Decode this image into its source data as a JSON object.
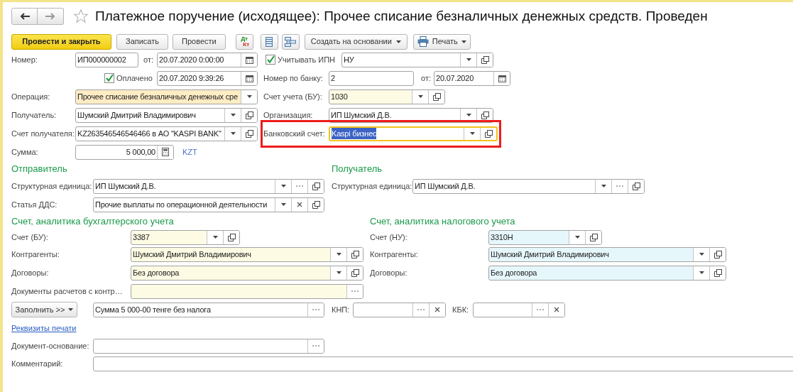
{
  "title": "Платежное поручение (исходящее): Прочее списание безналичных денежных средств. Проведен",
  "toolbar": [
    {
      "kind": "primary",
      "label": "Провести и закрыть"
    },
    {
      "kind": "button",
      "label": "Записать"
    },
    {
      "kind": "button",
      "label": "Провести"
    },
    {
      "kind": "dtkt",
      "top": "Дт",
      "bottom": "Кт"
    },
    {
      "kind": "list"
    },
    {
      "kind": "structure"
    },
    {
      "kind": "menu",
      "label": "Создать на основании"
    },
    {
      "kind": "print_menu",
      "label": "Печать"
    }
  ],
  "number": {
    "label": "Номер:",
    "value": "ИП000000002"
  },
  "date": {
    "label": "от:",
    "value": "20.07.2020  0:00:00",
    "buttons": [
      {
        "kind": "calendar"
      }
    ]
  },
  "ipn": {
    "label": "Учитывать ИПН",
    "checked": true
  },
  "tax_mode": {
    "value": "НУ",
    "buttons": [
      {
        "kind": "dropdown"
      },
      {
        "kind": "open"
      }
    ]
  },
  "paid": {
    "label": "Оплачено",
    "checked": true
  },
  "paid_date": {
    "value": "20.07.2020  9:39:26",
    "buttons": [
      {
        "kind": "calendar"
      }
    ]
  },
  "bank_number": {
    "label": "Номер по банку:",
    "value": "2"
  },
  "bank_date": {
    "label": "от:",
    "value": "20.07.2020",
    "buttons": [
      {
        "kind": "calendar"
      }
    ]
  },
  "operation": {
    "label": "Операция:",
    "value": "Прочее списание безналичных денежных сре",
    "color": "#fdecc4",
    "buttons": [
      {
        "kind": "dropdown"
      }
    ]
  },
  "account_bu": {
    "label": "Счет учета (БУ):",
    "value": "1030",
    "color": "#fdfbe4",
    "buttons": [
      {
        "kind": "dropdown"
      },
      {
        "kind": "open"
      }
    ]
  },
  "recipient": {
    "label": "Получатель:",
    "value": "Шумский Дмитрий Владимирович",
    "buttons": [
      {
        "kind": "dropdown"
      },
      {
        "kind": "open"
      }
    ]
  },
  "organization": {
    "label": "Организация:",
    "value": "ИП Шумский Д.В.",
    "buttons": [
      {
        "kind": "dropdown"
      },
      {
        "kind": "open"
      }
    ]
  },
  "recipient_account": {
    "label": "Счет получателя:",
    "value": "KZ263546546546466 в АО \"KASPI BANK\"",
    "buttons": [
      {
        "kind": "dropdown"
      },
      {
        "kind": "open"
      }
    ]
  },
  "bank_account": {
    "label": "Банковский счет:",
    "value": "Kaspi бизнес",
    "buttons": [
      {
        "kind": "dropdown"
      },
      {
        "kind": "open"
      }
    ],
    "focused": true,
    "framed": true
  },
  "amount": {
    "label": "Сумма:",
    "value": "5 000,00",
    "buttons": [
      {
        "kind": "calculator"
      }
    ],
    "currency": "KZT"
  },
  "sender": {
    "heading": "Отправитель",
    "unit": {
      "label": "Структурная единица:",
      "value": "ИП Шумский Д.В.",
      "buttons": [
        {
          "kind": "dropdown"
        },
        {
          "kind": "select"
        },
        {
          "kind": "open"
        }
      ]
    },
    "cash_item": {
      "label": "Статья ДДС:",
      "value": "Прочие выплаты по операционной деятельности",
      "buttons": [
        {
          "kind": "dropdown"
        },
        {
          "kind": "clear"
        },
        {
          "kind": "open"
        }
      ]
    }
  },
  "receiver": {
    "heading": "Получатель",
    "unit": {
      "label": "Структурная единица:",
      "value": "ИП Шумский Д.В.",
      "buttons": [
        {
          "kind": "dropdown"
        },
        {
          "kind": "select"
        },
        {
          "kind": "open"
        }
      ]
    }
  },
  "accounting": {
    "heading": "Счет, аналитика бухгалтерского учета",
    "account": {
      "label": "Счет (БУ):",
      "value": "3387",
      "color": "#fdfbe4",
      "buttons": [
        {
          "kind": "dropdown"
        },
        {
          "kind": "open"
        }
      ]
    },
    "counterparties": {
      "label": "Контрагенты:",
      "value": "Шумский Дмитрий Владимирович",
      "color": "#fdfbe4",
      "buttons": [
        {
          "kind": "dropdown"
        },
        {
          "kind": "open"
        }
      ]
    },
    "contracts": {
      "label": "Договоры:",
      "value": "Без договора",
      "color": "#fdfbe4",
      "buttons": [
        {
          "kind": "dropdown"
        },
        {
          "kind": "open"
        }
      ]
    },
    "settlement_docs": {
      "label": "Документы расчетов с контр…",
      "color": "#fdfbe4",
      "buttons": [
        {
          "kind": "select"
        }
      ]
    }
  },
  "tax": {
    "heading": "Счет, аналитика налогового учета",
    "account": {
      "label": "Счет (НУ):",
      "value": "3310Н",
      "color": "#e6f7fc",
      "buttons": [
        {
          "kind": "dropdown"
        },
        {
          "kind": "open"
        }
      ]
    },
    "counterparties": {
      "label": "Контрагенты:",
      "value": "Шумский Дмитрий Владимирович",
      "color": "#e6f7fc",
      "buttons": [
        {
          "kind": "dropdown"
        },
        {
          "kind": "open"
        }
      ]
    },
    "contracts": {
      "label": "Договоры:",
      "value": "Без договора",
      "color": "#e6f7fc",
      "buttons": [
        {
          "kind": "dropdown"
        },
        {
          "kind": "open"
        }
      ]
    }
  },
  "fill_button": {
    "label": "Заполнить >>"
  },
  "purpose": {
    "value": "Сумма 5 000-00  тенге  без налога",
    "buttons": [
      {
        "kind": "select"
      }
    ]
  },
  "knp": {
    "label": "КНП:",
    "buttons": [
      {
        "kind": "select"
      },
      {
        "kind": "clear"
      }
    ]
  },
  "kbk": {
    "label": "КБК:",
    "buttons": [
      {
        "kind": "select"
      },
      {
        "kind": "clear"
      }
    ]
  },
  "print_link": "Реквизиты печати",
  "base_document": {
    "label": "Документ-основание:",
    "buttons": [
      {
        "kind": "select"
      }
    ]
  },
  "comment": {
    "label": "Комментарий:"
  }
}
